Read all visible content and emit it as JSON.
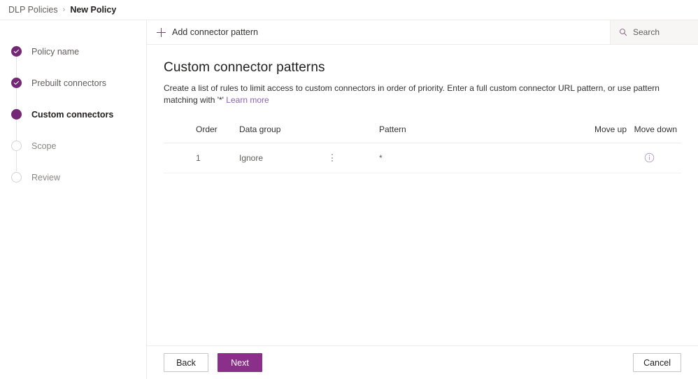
{
  "breadcrumb": {
    "parent": "DLP Policies",
    "separator": "›",
    "current": "New Policy"
  },
  "wizard": {
    "steps": [
      {
        "label": "Policy name",
        "state": "done",
        "icon": "check-circle-icon"
      },
      {
        "label": "Prebuilt connectors",
        "state": "done",
        "icon": "check-circle-icon"
      },
      {
        "label": "Custom connectors",
        "state": "current",
        "icon": "filled-circle-icon"
      },
      {
        "label": "Scope",
        "state": "todo",
        "icon": "empty-circle-icon"
      },
      {
        "label": "Review",
        "state": "todo",
        "icon": "empty-circle-icon"
      }
    ]
  },
  "commandbar": {
    "add_label": "Add connector pattern",
    "add_icon": "plus-icon",
    "search_icon": "search-icon",
    "search_placeholder": "Search",
    "search_value": ""
  },
  "main": {
    "title": "Custom connector patterns",
    "description_before_link": "Create a list of rules to limit access to custom connectors in order of priority. Enter a full custom connector URL pattern, or use pattern matching with '*' ",
    "link_label": "Learn more"
  },
  "table": {
    "headers": {
      "order": "Order",
      "data_group": "Data group",
      "pattern": "Pattern",
      "move_up": "Move up",
      "move_down": "Move down"
    },
    "rows": [
      {
        "order": "1",
        "data_group": "Ignore",
        "group_menu_icon": "kebab-menu-icon",
        "pattern": "*",
        "move_up": "",
        "move_down_icon": "info-icon"
      }
    ]
  },
  "footer": {
    "back_label": "Back",
    "next_label": "Next",
    "cancel_label": "Cancel"
  },
  "colors": {
    "accent_purple": "#742774",
    "primary_button": "#8A2F8A",
    "link": "#8764B8",
    "info_icon": "#B39BC8",
    "border": "#EDEBE9"
  }
}
